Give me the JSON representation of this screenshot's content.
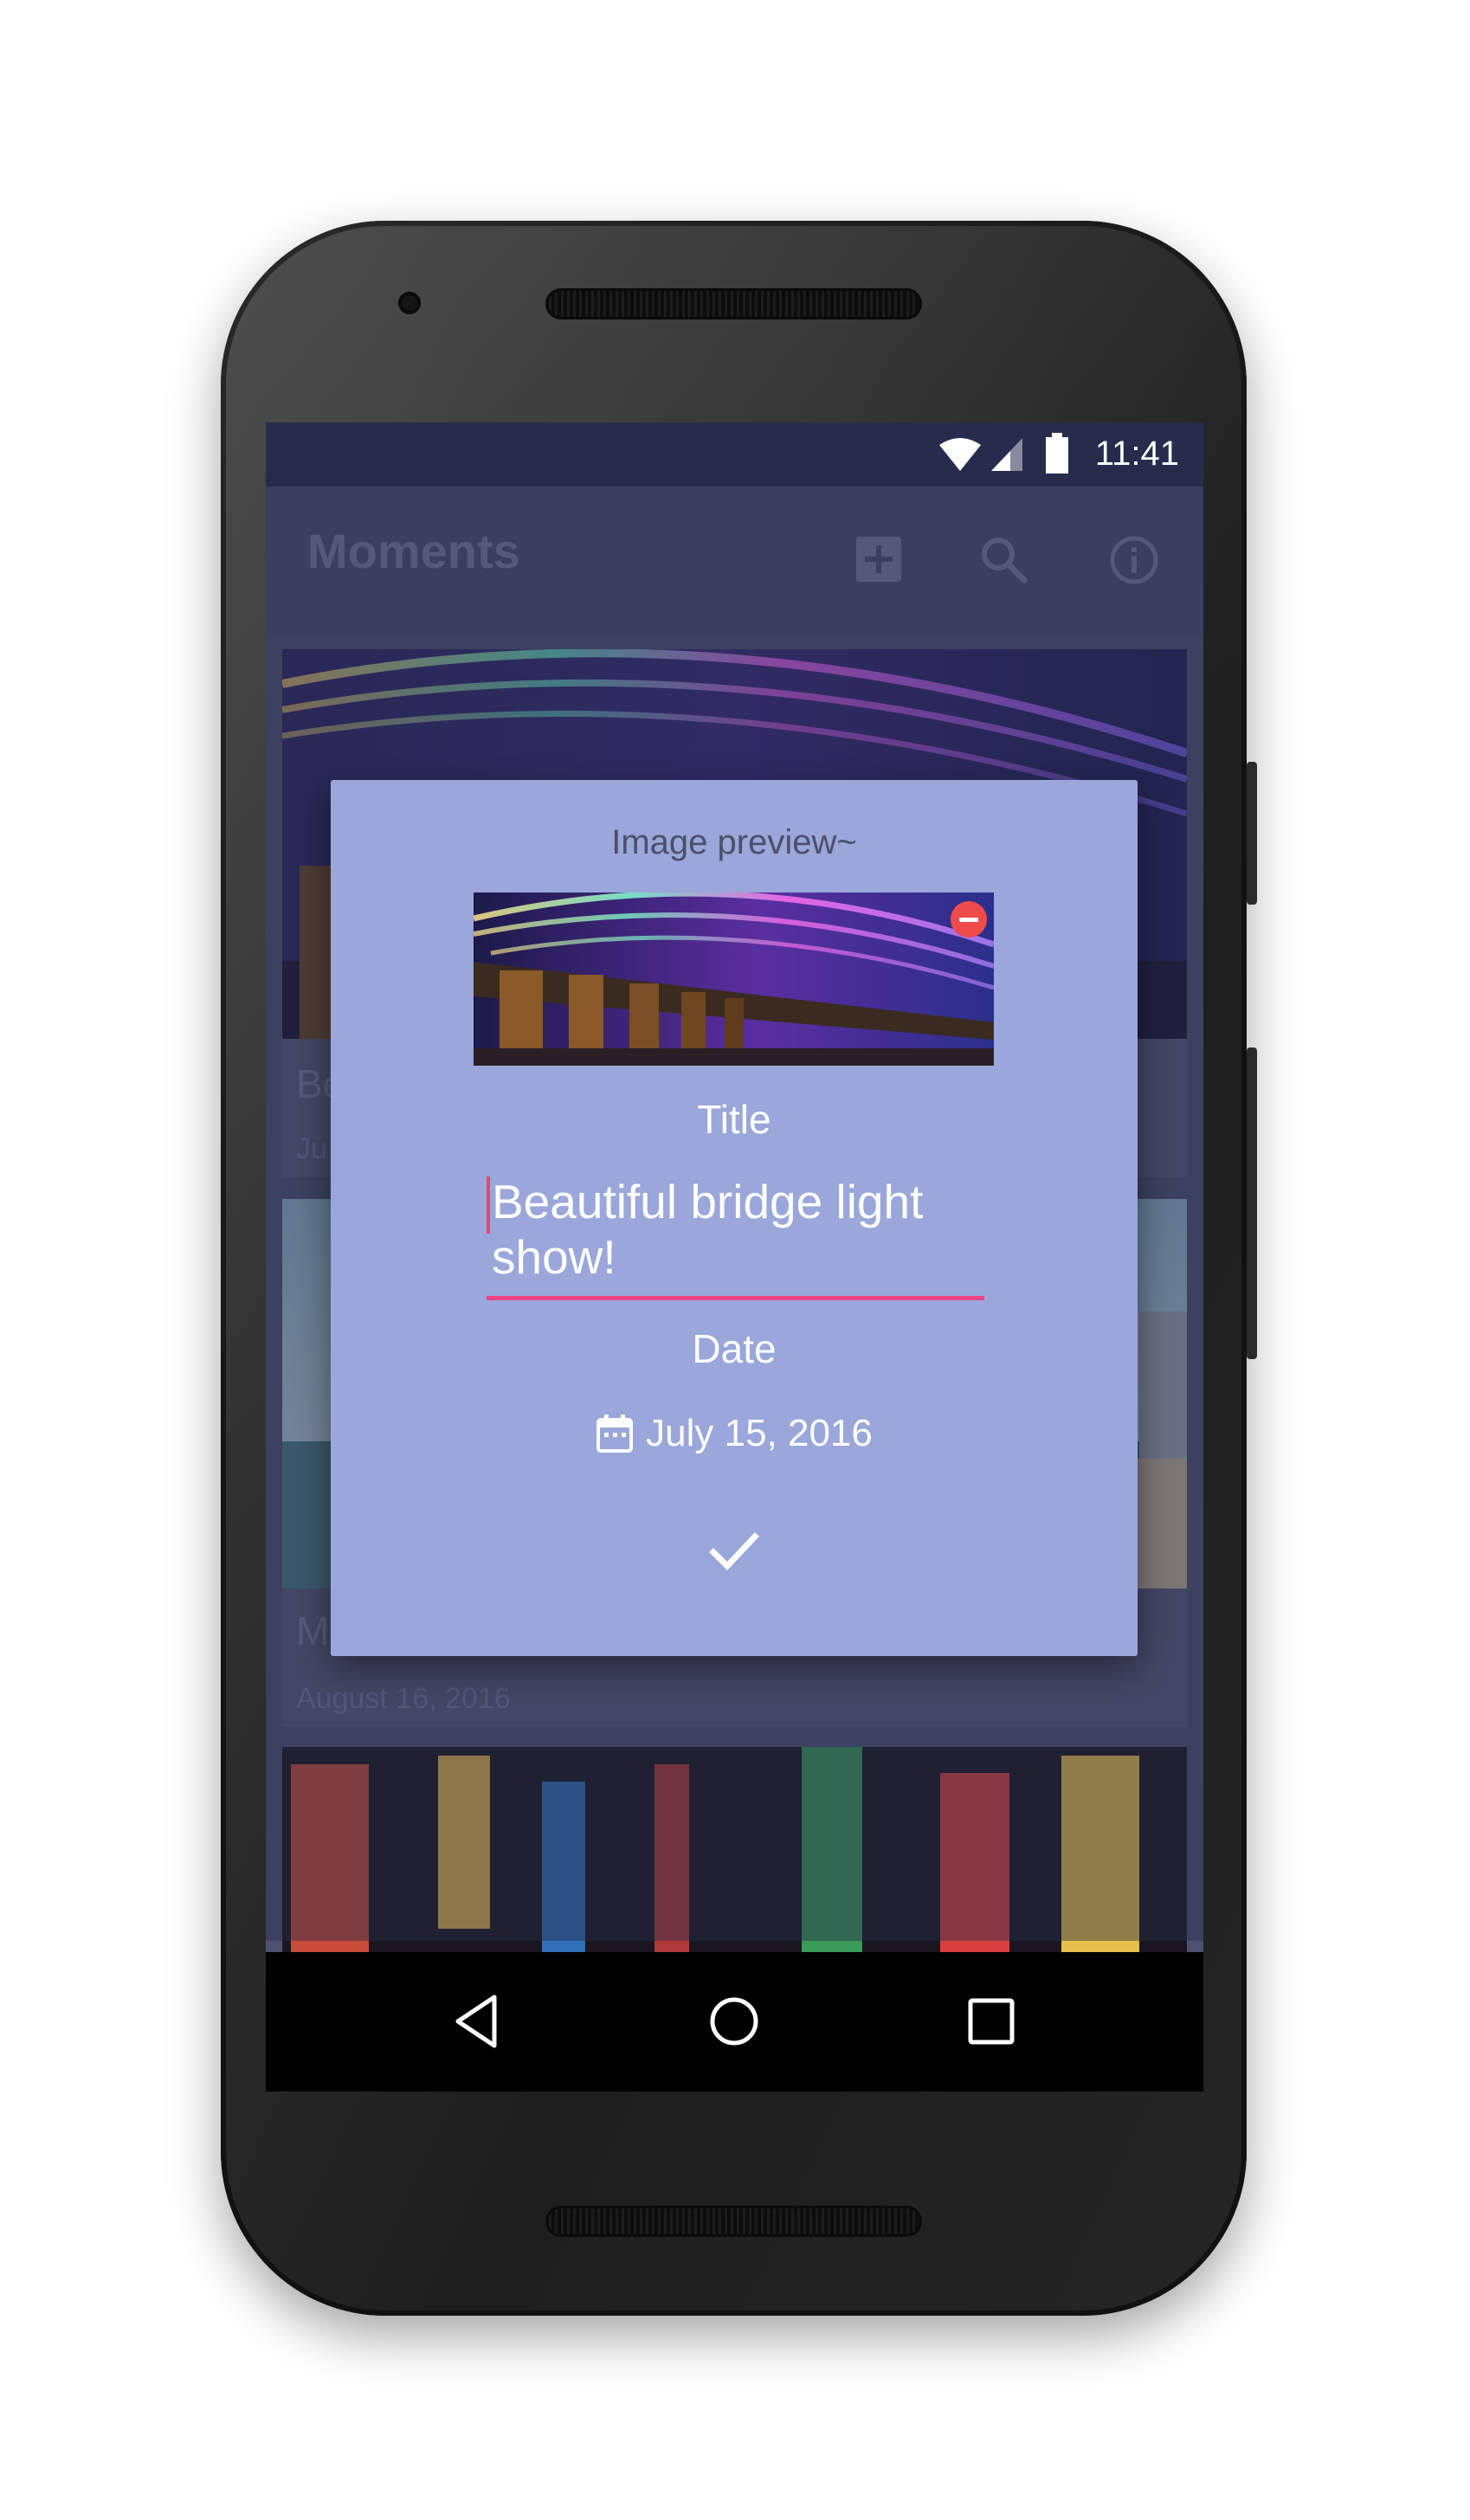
{
  "status_bar": {
    "time": "11:41"
  },
  "toolbar": {
    "title": "Moments",
    "icons": [
      "add-box-icon",
      "search-icon",
      "info-icon"
    ]
  },
  "cards": [
    {
      "title": "Be",
      "date": "Ju"
    },
    {
      "title": "M",
      "date": "August 16, 2016"
    }
  ],
  "dialog": {
    "heading": "Image preview~",
    "title_label": "Title",
    "title_value": "Beautiful bridge light show!",
    "date_label": "Date",
    "date_value": "July 15, 2016",
    "confirm_icon": "check-icon",
    "remove_icon": "remove-circle-icon",
    "accent": "#ec4482",
    "background": "#9ba6da"
  },
  "nav_bar": {
    "buttons": [
      "back-icon",
      "home-icon",
      "recents-icon"
    ]
  }
}
